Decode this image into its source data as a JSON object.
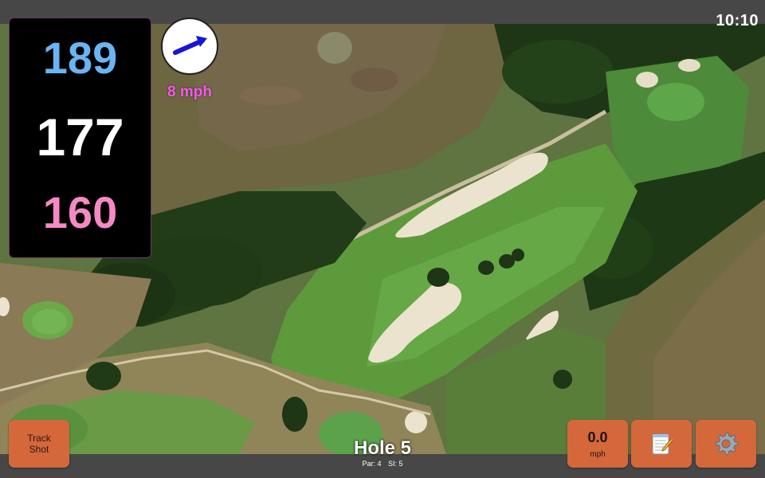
{
  "status_bar": {
    "time": "10:10"
  },
  "distances": {
    "back": "189",
    "middle": "177",
    "front": "160"
  },
  "distance_colors": {
    "back": "#6ab4f3",
    "middle": "#ffffff",
    "front": "#f589c5"
  },
  "wind": {
    "speed": "8 mph",
    "icon": "wind-arrow-icon",
    "direction": "northeast"
  },
  "track_button": {
    "line1": "Track",
    "line2": "Shot"
  },
  "speed_button": {
    "value": "0.0",
    "unit": "mph"
  },
  "notes_button": {
    "icon": "notepad-icon"
  },
  "settings_button": {
    "icon": "gear-icon"
  },
  "hole": {
    "title": "Hole 5",
    "par": "Par: 4",
    "si": "SI: 5"
  },
  "colors": {
    "button": "#d4683a",
    "wind_text": "#ef5fe0",
    "bar": "#474747"
  }
}
